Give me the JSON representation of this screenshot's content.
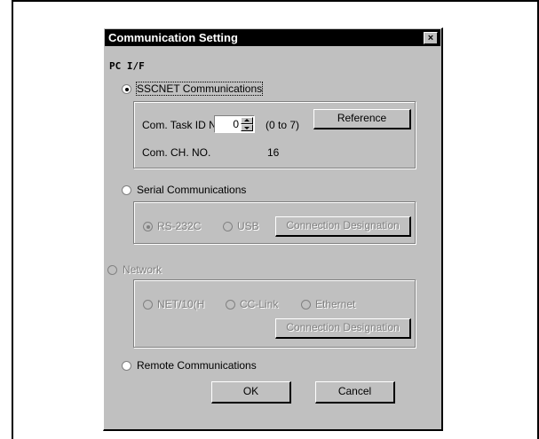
{
  "dialog": {
    "title": "Communication Setting",
    "close_symbol": "×"
  },
  "pc_if": "PC I/F",
  "sscnet": {
    "label": "SSCNET Communications",
    "selected": true,
    "task_id_label": "Com. Task ID NO",
    "task_id_value": "0",
    "range": "(0 to 7)",
    "reference_button": "Reference",
    "ch_label": "Com. CH. NO.",
    "ch_value": "16"
  },
  "serial": {
    "label": "Serial Communications",
    "rs232c": "RS-232C",
    "usb": "USB",
    "connection_button": "Connection Designation"
  },
  "network": {
    "label": "Network",
    "net10": "NET/10(H",
    "cclink": "CC-Link",
    "ethernet": "Ethernet",
    "connection_button": "Connection Designation"
  },
  "remote": {
    "label": "Remote Communications"
  },
  "buttons": {
    "ok": "OK",
    "cancel": "Cancel"
  }
}
